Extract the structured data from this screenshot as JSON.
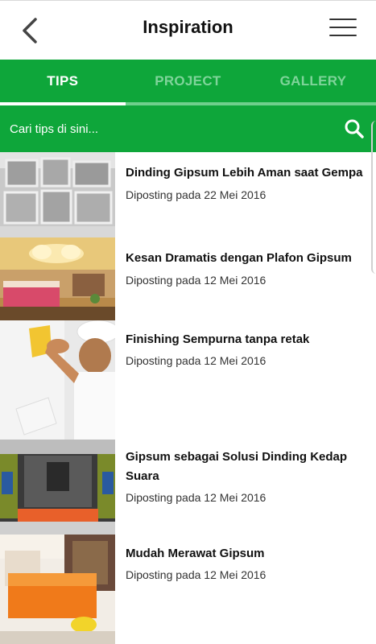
{
  "header": {
    "title": "Inspiration",
    "back_icon": "chevron-left-icon",
    "menu_icon": "hamburger-menu-icon"
  },
  "tabs": [
    {
      "label": "TIPS",
      "active": true
    },
    {
      "label": "PROJECT",
      "active": false
    },
    {
      "label": "GALLERY",
      "active": false
    }
  ],
  "search": {
    "placeholder": "Cari tips di sini...",
    "icon": "search-icon"
  },
  "articles": [
    {
      "title": "Dinding Gipsum Lebih Aman saat Gempa",
      "date": "Diposting pada 22 Mei 2016"
    },
    {
      "title": "Kesan Dramatis dengan Plafon Gipsum",
      "date": "Diposting pada 12 Mei 2016"
    },
    {
      "title": "Finishing Sempurna tanpa retak",
      "date": "Diposting pada 12 Mei 2016"
    },
    {
      "title": "Gipsum sebagai Solusi Dinding Kedap Suara",
      "date": "Diposting pada 12 Mei 2016"
    },
    {
      "title": "Mudah Merawat Gipsum",
      "date": "Diposting pada 12 Mei 2016"
    }
  ],
  "colors": {
    "brand_green": "#0ea63a",
    "inactive_tab": "#7fd49a"
  }
}
